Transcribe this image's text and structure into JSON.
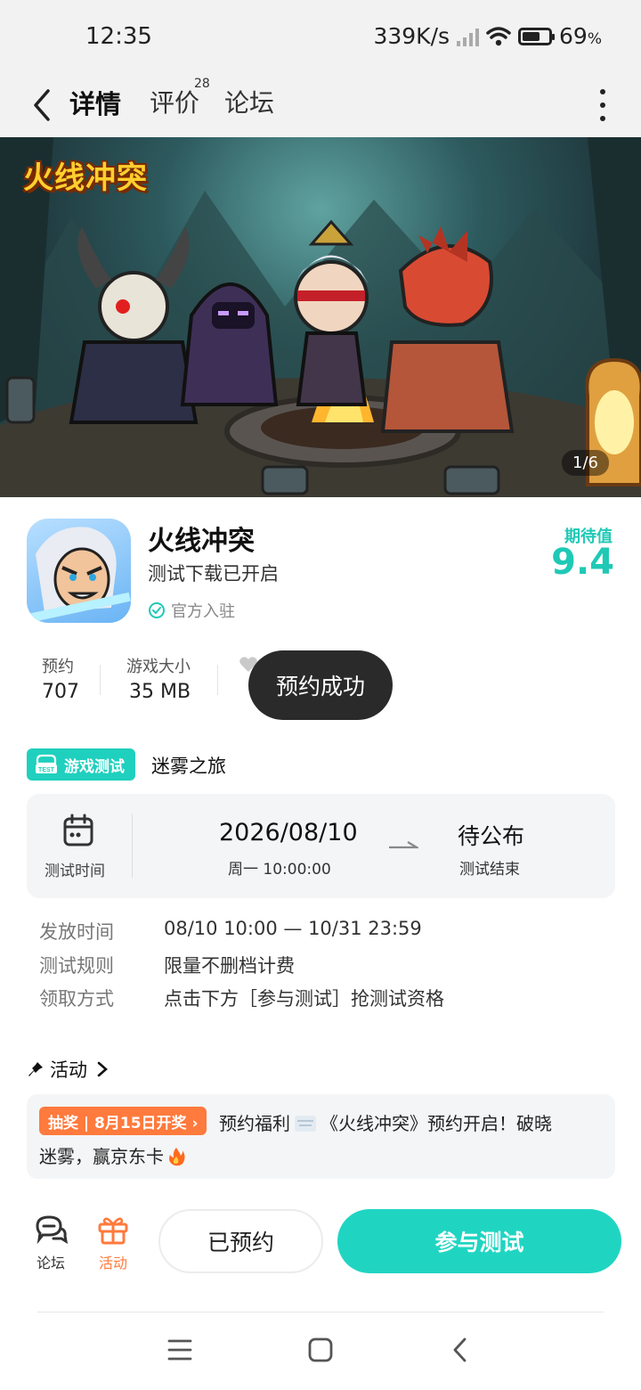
{
  "status_bar": {
    "time": "12:35",
    "net_speed": "339K/s",
    "battery_pct": "69",
    "pct_sign": "%",
    "battery_level": 0.69
  },
  "nav": {
    "tabs": [
      {
        "label": "详情"
      },
      {
        "label": "评价",
        "count": "28"
      },
      {
        "label": "论坛"
      }
    ]
  },
  "banner": {
    "logo_text": "火线冲突",
    "counter": "1/6"
  },
  "app": {
    "name": "火线冲突",
    "subtitle": "测试下载已开启",
    "official": "官方入驻",
    "expect_label": "期待值",
    "expect_value": "9.4"
  },
  "stats": [
    {
      "label": "预约",
      "value": "707"
    },
    {
      "label": "游戏大小",
      "value": "35 MB"
    }
  ],
  "toast": "预约成功",
  "test": {
    "badge": "游戏测试",
    "name": "迷雾之旅",
    "time_label": "测试时间",
    "start_date": "2026/08/10",
    "start_time": "周一  10:00:00",
    "end_title": "待公布",
    "end_sub": "测试结束",
    "info": [
      {
        "label": "发放时间",
        "value": "08/10 10:00 — 10/31 23:59"
      },
      {
        "label": "测试规则",
        "value": "限量不删档计费"
      },
      {
        "label": "领取方式",
        "value": "点击下方［参与测试］抢测试资格"
      }
    ]
  },
  "activity": {
    "heading": "活动",
    "tag": "抽奖 | 8月15日开奖 ›",
    "line1_a": "预约福利",
    "line1_b": "《火线冲突》预约开启！破晓",
    "line2": "迷雾，赢京东卡"
  },
  "bottom": {
    "forum_label": "论坛",
    "activity_label": "活动",
    "reserved_label": "已预约",
    "join_label": "参与测试"
  },
  "colors": {
    "accent": "#1fd0be",
    "orange": "#ff7a3d",
    "toast_bg": "#2a2a2a"
  }
}
